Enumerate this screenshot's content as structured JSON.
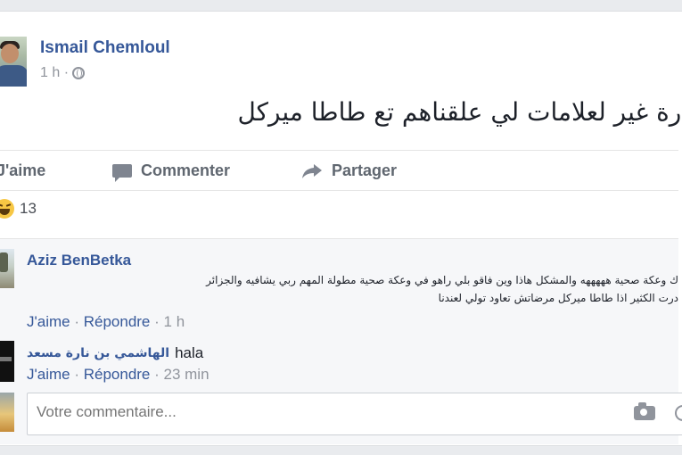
{
  "post": {
    "author": "Ismail Chemloul",
    "time": "1 h ·",
    "text": "ـارة غير لعلامات لي علقناهم تع طاطا ميركل"
  },
  "actions": {
    "like": "J'aime",
    "comment": "Commenter",
    "share": "Partager"
  },
  "reactions": {
    "icon": "haha-icon",
    "count": "13"
  },
  "comments": [
    {
      "author": "Aziz BenBetka",
      "line1": "ك وعكة صحية هههههه والمشكل هاذا وين فاقو بلي راهو في وعكة صحية مطولة المهم ربي يشافيه والجزائر",
      "line2": "درت الكثير اذا طاطا ميركل مرضاتش تعاود تولي لعندنا",
      "like": "J'aime",
      "reply": "Répondre",
      "time": "1 h"
    },
    {
      "author": "الهاشمي بن نارة مسعد",
      "text": "hala",
      "like": "J'aime",
      "reply": "Répondre",
      "time": "23 min"
    }
  ],
  "composer": {
    "placeholder": "Votre commentaire..."
  },
  "colors": {
    "link": "#365899",
    "secondary": "#90949c"
  }
}
